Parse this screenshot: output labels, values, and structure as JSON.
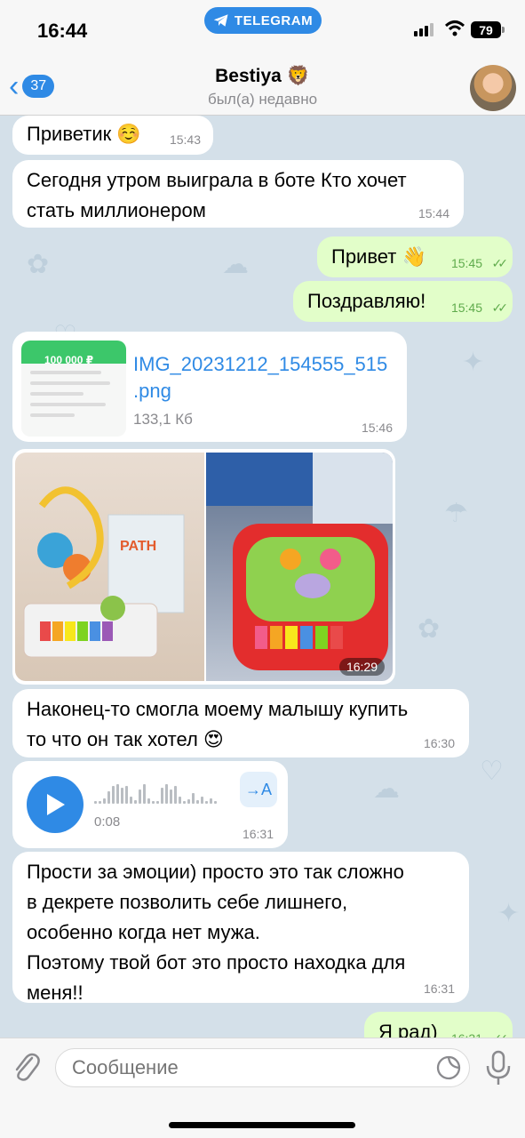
{
  "status_bar": {
    "time": "16:44",
    "app_pill": "TELEGRAM",
    "battery": "79"
  },
  "header": {
    "back_badge": "37",
    "name": "Bestiya 🦁",
    "status": "был(а) недавно"
  },
  "messages": [
    {
      "id": "m1",
      "dir": "in",
      "text": "Приветик ☺️",
      "time": "15:43"
    },
    {
      "id": "m2",
      "dir": "in",
      "lines": [
        "Сегодня утром выиграла в боте Кто хочет",
        "стать миллионером"
      ],
      "time": "15:44"
    },
    {
      "id": "m3",
      "dir": "out",
      "text": "Привет 👋",
      "time": "15:45"
    },
    {
      "id": "m4",
      "dir": "out",
      "text": "Поздравляю!",
      "time": "15:45"
    },
    {
      "id": "m5",
      "dir": "in",
      "type": "file",
      "thumb_amount": "100 000 ₽",
      "file_lines": [
        "IMG_20231212_154555_515",
        ".png"
      ],
      "size": "133,1 Кб",
      "time": "15:46"
    },
    {
      "id": "m6",
      "dir": "in",
      "type": "photos",
      "time": "16:29"
    },
    {
      "id": "m7",
      "dir": "in",
      "lines": [
        "Наконец-то смогла моему малышу купить",
        "то что он так хотел 😍"
      ],
      "time": "16:30"
    },
    {
      "id": "m8",
      "dir": "in",
      "type": "voice",
      "duration": "0:08",
      "transcribe_label": "→A",
      "time": "16:31"
    },
    {
      "id": "m9",
      "dir": "in",
      "lines": [
        "Прости за эмоции) просто это так сложно",
        "в декрете позволить себе лишнего,",
        "особенно когда нет мужа.",
        "Поэтому твой бот это просто находка для",
        "меня!!"
      ],
      "time": "16:31"
    },
    {
      "id": "m10",
      "dir": "out",
      "text": "Я рад)",
      "time": "16:31"
    }
  ],
  "input": {
    "placeholder": "Сообщение"
  },
  "colors": {
    "accent": "#2f8ae5",
    "outgoing_bubble": "#e2fec9",
    "incoming_bubble": "#ffffff",
    "chat_bg": "#d4e0e9"
  }
}
